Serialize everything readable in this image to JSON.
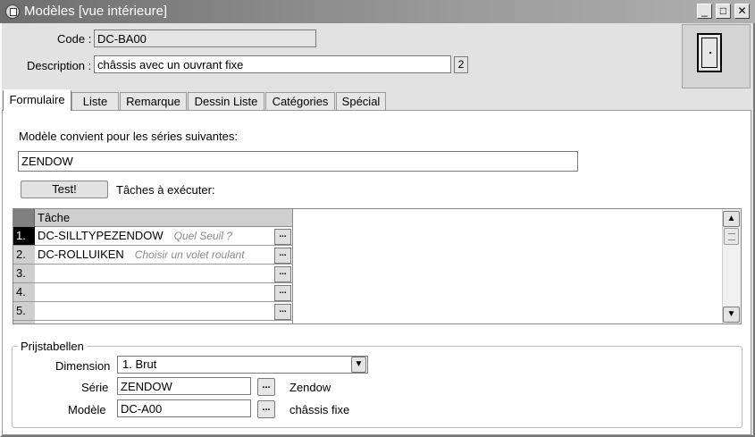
{
  "window": {
    "title": "Modèles [vue intérieure]",
    "minimize_glyph": "_",
    "maximize_glyph": "□",
    "close_glyph": "✕"
  },
  "header": {
    "code_label": "Code :",
    "code_value": "DC-BA00",
    "description_label": "Description :",
    "description_value": "châssis avec un ouvrant fixe",
    "description_badge": "2"
  },
  "tabs": [
    {
      "label": "Formulaire",
      "active": true
    },
    {
      "label": "Liste"
    },
    {
      "label": "Remarque"
    },
    {
      "label": "Dessin Liste"
    },
    {
      "label": "Catégories"
    },
    {
      "label": "Spécial"
    }
  ],
  "form": {
    "series_label": "Modèle convient pour les séries suivantes:",
    "series_value": "ZENDOW",
    "test_button": "Test!",
    "tasks_label": "Tâches à exécuter:"
  },
  "grid": {
    "column_header": "Tâche",
    "cell_button": "...",
    "rows": [
      {
        "no": "1.",
        "code": "DC-SILLTYPEZENDOW",
        "hint": "Quel Seuil ?",
        "selected": true
      },
      {
        "no": "2.",
        "code": "DC-ROLLUIKEN",
        "hint": "Choisir un volet roulant"
      },
      {
        "no": "3.",
        "code": "",
        "hint": ""
      },
      {
        "no": "4.",
        "code": "",
        "hint": ""
      },
      {
        "no": "5.",
        "code": "",
        "hint": ""
      }
    ],
    "scroll_up": "▲",
    "scroll_down": "▼"
  },
  "prijstabellen": {
    "group_title": "Prijstabellen",
    "dimension_label": "Dimension",
    "dimension_value": "1.  Brut",
    "dropdown_glyph": "▼",
    "serie_label": "Série",
    "serie_value": "ZENDOW",
    "serie_name": "Zendow",
    "modele_label": "Modèle",
    "modele_value": "DC-A00",
    "modele_name": "châssis fixe",
    "browse_button": "..."
  }
}
